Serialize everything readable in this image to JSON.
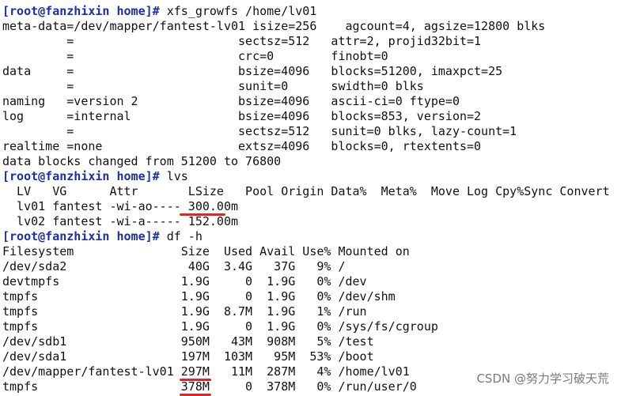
{
  "colors": {
    "prompt": "#1c2fa8",
    "text": "#111111",
    "annotation": "#e0262a",
    "watermark": "#7a7a7a"
  },
  "lines": [
    {
      "prompt": "[root@fanzhixin home]#",
      "command": " xfs_growfs /home/lv01"
    },
    {
      "text": "meta-data=/dev/mapper/fantest-lv01 isize=256    agcount=4, agsize=12800 blks"
    },
    {
      "text": "         =                       sectsz=512   attr=2, projid32bit=1"
    },
    {
      "text": "         =                       crc=0        finobt=0"
    },
    {
      "text": "data     =                       bsize=4096   blocks=51200, imaxpct=25"
    },
    {
      "text": "         =                       sunit=0      swidth=0 blks"
    },
    {
      "text": "naming   =version 2              bsize=4096   ascii-ci=0 ftype=0"
    },
    {
      "text": "log      =internal               bsize=4096   blocks=853, version=2"
    },
    {
      "text": "         =                       sectsz=512   sunit=0 blks, lazy-count=1"
    },
    {
      "text": "realtime =none                   extsz=4096   blocks=0, rtextents=0"
    },
    {
      "text": "data blocks changed from 51200 to 76800"
    },
    {
      "prompt": "[root@fanzhixin home]#",
      "command": " lvs"
    },
    {
      "text": "  LV   VG      Attr       LSize   Pool Origin Data%  Meta%  Move Log Cpy%Sync Convert"
    },
    {
      "text": "  lv01 fantest -wi-ao---- 300.00m"
    },
    {
      "text": "  lv02 fantest -wi-a----- 152.00m"
    },
    {
      "prompt": "[root@fanzhixin home]#",
      "command": " df -h"
    },
    {
      "text": "Filesystem               Size  Used Avail Use% Mounted on"
    },
    {
      "text": "/dev/sda2                 40G  3.4G   37G   9% /"
    },
    {
      "text": "devtmpfs                 1.9G     0  1.9G   0% /dev"
    },
    {
      "text": "tmpfs                    1.9G     0  1.9G   0% /dev/shm"
    },
    {
      "text": "tmpfs                    1.9G  8.7M  1.9G   1% /run"
    },
    {
      "text": "tmpfs                    1.9G     0  1.9G   0% /sys/fs/cgroup"
    },
    {
      "text": "/dev/sdb1                950M   43M  908M   5% /test"
    },
    {
      "text": "/dev/sda1                197M  103M   95M  53% /boot"
    },
    {
      "text": "/dev/mapper/fantest-lv01 297M   11M  287M   4% /home/lv01"
    },
    {
      "text": "tmpfs                    378M     0  378M   0% /run/user/0"
    }
  ],
  "annotations": [
    {
      "line": 13,
      "col": 25,
      "chars": 6
    },
    {
      "line": 24,
      "col": 25,
      "chars": 4
    },
    {
      "line": 25,
      "col": 25,
      "chars": 4
    }
  ],
  "watermark": "CSDN @努力学习破天荒"
}
